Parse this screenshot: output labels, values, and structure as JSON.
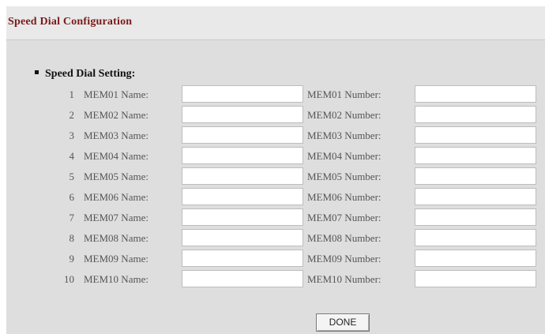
{
  "page": {
    "title": "Speed Dial Configuration"
  },
  "section": {
    "heading": "Speed Dial Setting:"
  },
  "rows": [
    {
      "index": "1",
      "name_label": "MEM01 Name:",
      "number_label": "MEM01 Number:",
      "name_value": "",
      "number_value": ""
    },
    {
      "index": "2",
      "name_label": "MEM02 Name:",
      "number_label": "MEM02 Number:",
      "name_value": "",
      "number_value": ""
    },
    {
      "index": "3",
      "name_label": "MEM03 Name:",
      "number_label": "MEM03 Number:",
      "name_value": "",
      "number_value": ""
    },
    {
      "index": "4",
      "name_label": "MEM04 Name:",
      "number_label": "MEM04 Number:",
      "name_value": "",
      "number_value": ""
    },
    {
      "index": "5",
      "name_label": "MEM05 Name:",
      "number_label": "MEM05 Number:",
      "name_value": "",
      "number_value": ""
    },
    {
      "index": "6",
      "name_label": "MEM06 Name:",
      "number_label": "MEM06 Number:",
      "name_value": "",
      "number_value": ""
    },
    {
      "index": "7",
      "name_label": "MEM07 Name:",
      "number_label": "MEM07 Number:",
      "name_value": "",
      "number_value": ""
    },
    {
      "index": "8",
      "name_label": "MEM08 Name:",
      "number_label": "MEM08 Number:",
      "name_value": "",
      "number_value": ""
    },
    {
      "index": "9",
      "name_label": "MEM09 Name:",
      "number_label": "MEM09 Number:",
      "name_value": "",
      "number_value": ""
    },
    {
      "index": "10",
      "name_label": "MEM10 Name:",
      "number_label": "MEM10 Number:",
      "name_value": "",
      "number_value": ""
    }
  ],
  "buttons": {
    "done_label": "DONE"
  },
  "colors": {
    "title": "#7a1a1a",
    "panel_background": "#dedede"
  }
}
